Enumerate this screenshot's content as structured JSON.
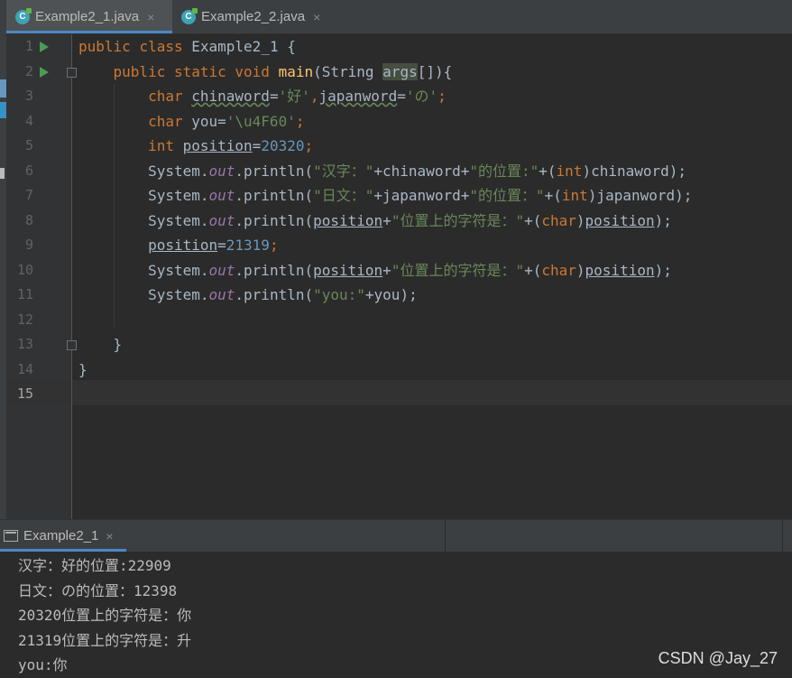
{
  "editor_tabs": [
    {
      "label": "Example2_1.java",
      "active": true
    },
    {
      "label": "Example2_2.java",
      "active": false
    }
  ],
  "tab_close_glyph": "×",
  "line_numbers": [
    "1",
    "2",
    "3",
    "4",
    "5",
    "6",
    "7",
    "8",
    "9",
    "10",
    "11",
    "12",
    "13",
    "14",
    "15"
  ],
  "code": {
    "l1": {
      "kw1": "public",
      "kw2": "class",
      "name": "Example2_1 {"
    },
    "l2": {
      "kw1": "public",
      "kw2": "static",
      "kw3": "void",
      "fn": "main",
      "p1": "(String ",
      "param": "args",
      "p2": "[]){"
    },
    "l3": {
      "kw": "char",
      "v1": "chinaword",
      "eq1": "=",
      "s1": "'好'",
      "c": ",",
      "v2": "japanword",
      "eq2": "=",
      "s2": "'の'",
      "end": ";"
    },
    "l4": {
      "kw": "char",
      "rest": "you=",
      "s": "'\\u4F60'",
      "end": ";"
    },
    "l5": {
      "kw": "int",
      "v": "position",
      "eq": "=",
      "n": "20320",
      "end": ";"
    },
    "l6": {
      "sys": "System.",
      "out": "out",
      "pr": ".println(",
      "s1": "\"汉字：\"",
      "mid": "+chinaword+",
      "s2": "\"的位置:\"",
      "p": "+(",
      "kw": "int",
      "end": ")chinaword);"
    },
    "l7": {
      "sys": "System.",
      "out": "out",
      "pr": ".println(",
      "s1": "\"日文：\"",
      "mid": "+japanword+",
      "s2": "\"的位置：\"",
      "p": "+(",
      "kw": "int",
      "end": ")japanword);"
    },
    "l8": {
      "sys": "System.",
      "out": "out",
      "pr": ".println(",
      "v1": "position",
      "plus": "+",
      "s": "\"位置上的字符是：\"",
      "p": "+(",
      "kw": "char",
      "c": ")",
      "v2": "position",
      "end": ");"
    },
    "l9": {
      "v": "position",
      "eq": "=",
      "n": "21319",
      "end": ";"
    },
    "l10": {
      "sys": "System.",
      "out": "out",
      "pr": ".println(",
      "v1": "position",
      "plus": "+",
      "s": "\"位置上的字符是：\"",
      "p": "+(",
      "kw": "char",
      "c": ")",
      "v2": "position",
      "end": ");"
    },
    "l11": {
      "sys": "System.",
      "out": "out",
      "pr": ".println(",
      "s": "\"you:\"",
      "end": "+you);"
    },
    "l13": "}",
    "l14": "}"
  },
  "run_tab": {
    "label": "Example2_1"
  },
  "console_output": [
    "汉字：好的位置:22909",
    "日文：の的位置：12398",
    "20320位置上的字符是：你",
    "21319位置上的字符是：升",
    "you:你"
  ],
  "watermark": "CSDN @Jay_27",
  "colors": {
    "keyword": "#cc7832",
    "string": "#6a8759",
    "number": "#6897bb",
    "function": "#ffc66d",
    "static_field": "#9876aa",
    "default_text": "#a9b7c6",
    "accent": "#4a88c7"
  }
}
